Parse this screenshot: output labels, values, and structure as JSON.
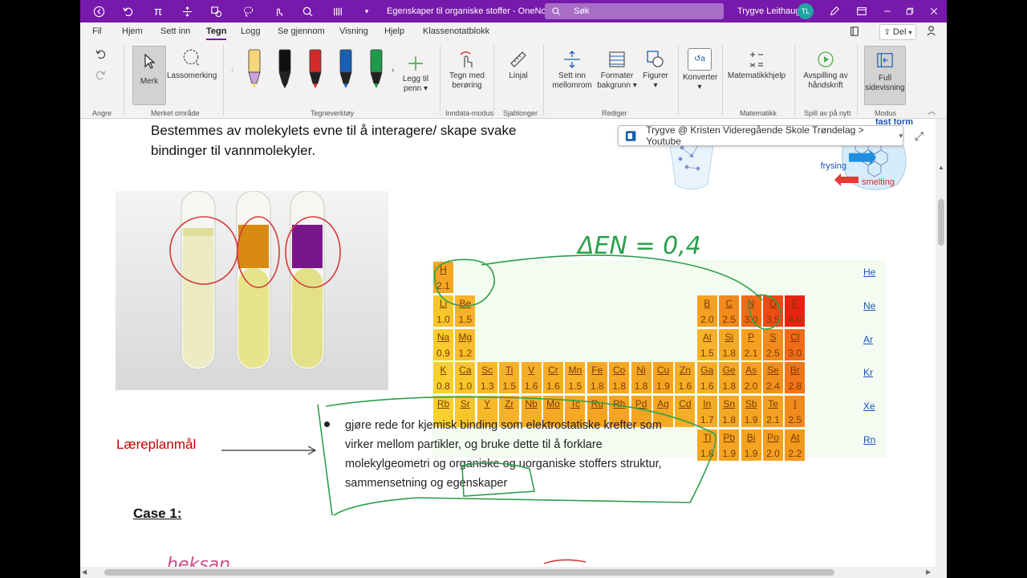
{
  "window": {
    "title": "Egenskaper til organiske stoffer  -  OneNote",
    "search_placeholder": "Søk",
    "user_name": "Trygve Leithaug",
    "user_initials": "TL"
  },
  "tabs": [
    "Fil",
    "Hjem",
    "Sett inn",
    "Tegn",
    "Logg",
    "Se gjennom",
    "Visning",
    "Hjelp",
    "Klassenotatblokk"
  ],
  "share_label": "Del",
  "ribbon": {
    "merk": "Merk",
    "lasso": "Lassomerking",
    "legg_til_penn_1": "Legg til",
    "legg_til_penn_2": "penn",
    "tegn_med_beroring_1": "Tegn med",
    "tegn_med_beroring_2": "berøring",
    "linjal": "Linjal",
    "sett_inn_mellomrom_1": "Sett inn",
    "sett_inn_mellomrom_2": "mellomrom",
    "formater_bakgrunn_1": "Formater",
    "formater_bakgrunn_2": "bakgrunn",
    "figurer": "Figurer",
    "konverter": "Konverter",
    "matematikkhjelp": "Matematikkhjelp",
    "avspilling_1": "Avspilling av",
    "avspilling_2": "håndskrift",
    "full_sidevisning_1": "Full",
    "full_sidevisning_2": "sidevisning",
    "groups": {
      "angre": "Angre",
      "merket_omrade": "Merket område",
      "tegneverktoy": "Tegneverktøy",
      "inndata_modus": "Inndata-modus",
      "sjablonger": "Sjablonger",
      "rediger": "Rediger",
      "matematikk": "Matematikk",
      "spill_av_pa_nytt": "Spill av på nytt",
      "modus": "Modus"
    },
    "pen_colors": [
      "#f5d77a",
      "#111111",
      "#d42a2a",
      "#1a5fb4",
      "#1e9b4a"
    ]
  },
  "page": {
    "text_line1": "Bestemmes av molekylets evne til å interagere/ skape svake",
    "text_line2": "bindinger til vannmolekyler.",
    "tooltip": "Trygve @ Kristen Videregående Skole Trøndelag > Youtube",
    "ice_fast_form": "fast form",
    "ice_frysing": "frysing",
    "ice_smelting": "smelting",
    "delta_en": "ΔEN = 0,4",
    "laereplan_label": "Læreplanmål",
    "laereplan_lines": [
      "gjøre rede for kjemisk binding som elektrostatiske krefter som",
      "virker mellom partikler, og bruke dette til å forklare",
      "molekylgeometri og organiske og uorganiske stoffers struktur,",
      "sammensetning og egenskaper"
    ],
    "case_label": "Case 1:",
    "handwriting_bottom": "heksan"
  },
  "periodic_table": {
    "elements": [
      {
        "s": "H",
        "v": "2.1",
        "c": 0,
        "r": 0,
        "col": "#f5a623"
      },
      {
        "s": "Li",
        "v": "1.0",
        "c": 0,
        "r": 1,
        "col": "#f7c62a"
      },
      {
        "s": "Be",
        "v": "1.5",
        "c": 1,
        "r": 1,
        "col": "#f7b22a"
      },
      {
        "s": "B",
        "v": "2.0",
        "c": 12,
        "r": 1,
        "col": "#f5a020"
      },
      {
        "s": "C",
        "v": "2.5",
        "c": 13,
        "r": 1,
        "col": "#f38a1c"
      },
      {
        "s": "N",
        "v": "3.0",
        "c": 14,
        "r": 1,
        "col": "#f06a18"
      },
      {
        "s": "O",
        "v": "3.5",
        "c": 15,
        "r": 1,
        "col": "#ed4a14"
      },
      {
        "s": "F",
        "v": "4.0",
        "c": 16,
        "r": 1,
        "col": "#e8220f"
      },
      {
        "s": "Na",
        "v": "0.9",
        "c": 0,
        "r": 2,
        "col": "#f8cc2c"
      },
      {
        "s": "Mg",
        "v": "1.2",
        "c": 1,
        "r": 2,
        "col": "#f7bd2a"
      },
      {
        "s": "Al",
        "v": "1.5",
        "c": 12,
        "r": 2,
        "col": "#f7b22a"
      },
      {
        "s": "Si",
        "v": "1.8",
        "c": 13,
        "r": 2,
        "col": "#f5a823"
      },
      {
        "s": "P",
        "v": "2.1",
        "c": 14,
        "r": 2,
        "col": "#f5a020"
      },
      {
        "s": "S",
        "v": "2.5",
        "c": 15,
        "r": 2,
        "col": "#f38a1c"
      },
      {
        "s": "Cl",
        "v": "3.0",
        "c": 16,
        "r": 2,
        "col": "#f06a18"
      },
      {
        "s": "K",
        "v": "0.8",
        "c": 0,
        "r": 3,
        "col": "#f8d02e"
      },
      {
        "s": "Ca",
        "v": "1.0",
        "c": 1,
        "r": 3,
        "col": "#f7c62a"
      },
      {
        "s": "Sc",
        "v": "1.3",
        "c": 2,
        "r": 3,
        "col": "#f7b92a"
      },
      {
        "s": "Ti",
        "v": "1.5",
        "c": 3,
        "r": 3,
        "col": "#f7b22a"
      },
      {
        "s": "V",
        "v": "1.6",
        "c": 4,
        "r": 3,
        "col": "#f6ae27"
      },
      {
        "s": "Cr",
        "v": "1.6",
        "c": 5,
        "r": 3,
        "col": "#f6ae27"
      },
      {
        "s": "Mn",
        "v": "1.5",
        "c": 6,
        "r": 3,
        "col": "#f7b22a"
      },
      {
        "s": "Fe",
        "v": "1.8",
        "c": 7,
        "r": 3,
        "col": "#f5a823"
      },
      {
        "s": "Co",
        "v": "1.8",
        "c": 8,
        "r": 3,
        "col": "#f5a823"
      },
      {
        "s": "Ni",
        "v": "1.8",
        "c": 9,
        "r": 3,
        "col": "#f5a823"
      },
      {
        "s": "Cu",
        "v": "1.9",
        "c": 10,
        "r": 3,
        "col": "#f5a421"
      },
      {
        "s": "Zn",
        "v": "1.6",
        "c": 11,
        "r": 3,
        "col": "#f6ae27"
      },
      {
        "s": "Ga",
        "v": "1.6",
        "c": 12,
        "r": 3,
        "col": "#f6ae27"
      },
      {
        "s": "Ge",
        "v": "1.8",
        "c": 13,
        "r": 3,
        "col": "#f5a823"
      },
      {
        "s": "As",
        "v": "2.0",
        "c": 14,
        "r": 3,
        "col": "#f5a020"
      },
      {
        "s": "Se",
        "v": "2.4",
        "c": 15,
        "r": 3,
        "col": "#f3901d"
      },
      {
        "s": "Br",
        "v": "2.8",
        "c": 16,
        "r": 3,
        "col": "#f17419"
      },
      {
        "s": "Rb",
        "v": "",
        "c": 0,
        "r": 4,
        "col": "#f8d02e"
      },
      {
        "s": "Sr",
        "v": "",
        "c": 1,
        "r": 4,
        "col": "#f7c62a"
      },
      {
        "s": "Y",
        "v": "",
        "c": 2,
        "r": 4,
        "col": "#f7b92a"
      },
      {
        "s": "Zr",
        "v": "",
        "c": 3,
        "r": 4,
        "col": "#f7b22a"
      },
      {
        "s": "Nb",
        "v": "",
        "c": 4,
        "r": 4,
        "col": "#f6ae27"
      },
      {
        "s": "Mo",
        "v": "",
        "c": 5,
        "r": 4,
        "col": "#f5a823"
      },
      {
        "s": "Tc",
        "v": "",
        "c": 6,
        "r": 4,
        "col": "#f5a823"
      },
      {
        "s": "Ru",
        "v": "",
        "c": 7,
        "r": 4,
        "col": "#f5a421"
      },
      {
        "s": "Rh",
        "v": "",
        "c": 8,
        "r": 4,
        "col": "#f5a421"
      },
      {
        "s": "Pd",
        "v": "",
        "c": 9,
        "r": 4,
        "col": "#f5a421"
      },
      {
        "s": "Ag",
        "v": "",
        "c": 10,
        "r": 4,
        "col": "#f5a823"
      },
      {
        "s": "Cd",
        "v": "",
        "c": 11,
        "r": 4,
        "col": "#f6ae27"
      },
      {
        "s": "In",
        "v": "1.7",
        "c": 12,
        "r": 4,
        "col": "#f6ab25"
      },
      {
        "s": "Sn",
        "v": "1.8",
        "c": 13,
        "r": 4,
        "col": "#f5a823"
      },
      {
        "s": "Sb",
        "v": "1.9",
        "c": 14,
        "r": 4,
        "col": "#f5a421"
      },
      {
        "s": "Te",
        "v": "2.1",
        "c": 15,
        "r": 4,
        "col": "#f5a020"
      },
      {
        "s": "I",
        "v": "2.5",
        "c": 16,
        "r": 4,
        "col": "#f38a1c"
      },
      {
        "s": "Tl",
        "v": "1.8",
        "c": 12,
        "r": 5,
        "col": "#f5a823"
      },
      {
        "s": "Pb",
        "v": "1.9",
        "c": 13,
        "r": 5,
        "col": "#f5a421"
      },
      {
        "s": "Bi",
        "v": "1.9",
        "c": 14,
        "r": 5,
        "col": "#f5a421"
      },
      {
        "s": "Po",
        "v": "2.0",
        "c": 15,
        "r": 5,
        "col": "#f5a020"
      },
      {
        "s": "At",
        "v": "2.2",
        "c": 16,
        "r": 5,
        "col": "#f4981e"
      }
    ],
    "noble": [
      "He",
      "Ne",
      "Ar",
      "Kr",
      "Xe",
      "Rn"
    ]
  }
}
